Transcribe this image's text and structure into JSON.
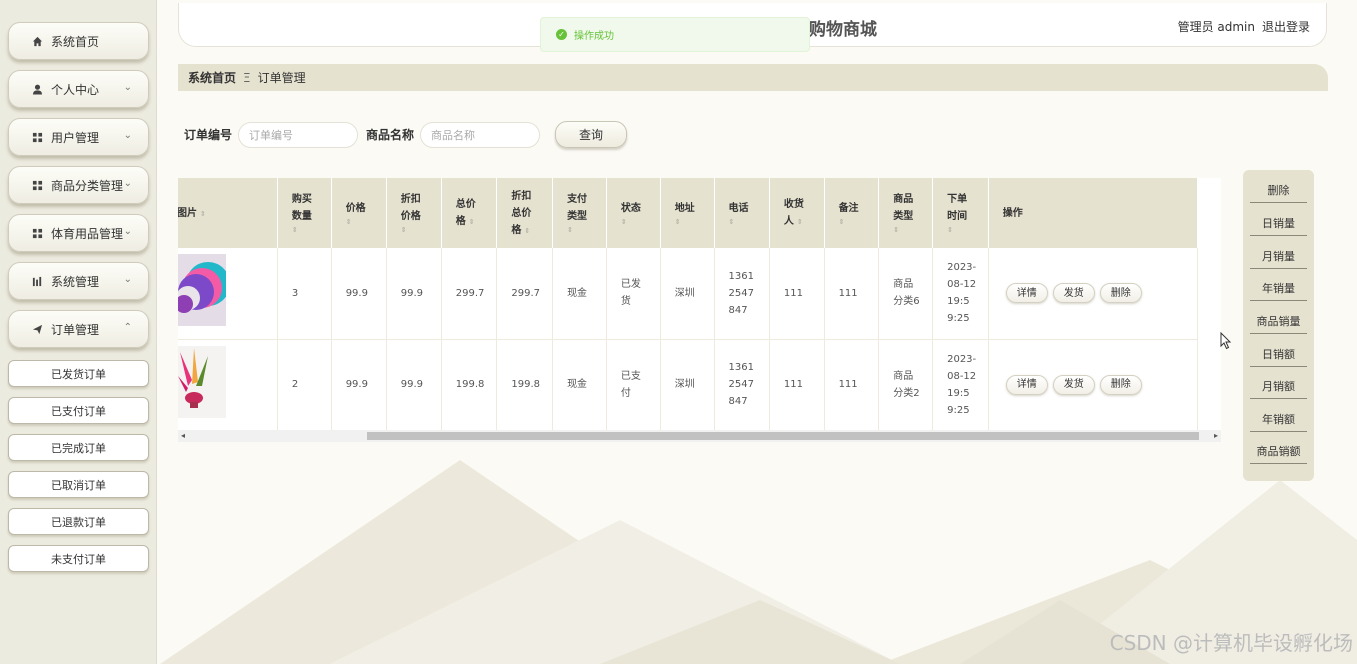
{
  "app": {
    "title": "购物商城",
    "admin_text": "管理员 admin",
    "logout": "退出登录"
  },
  "toast": {
    "text": "操作成功"
  },
  "sidebar": {
    "items": [
      {
        "label": "系统首页",
        "icon": "home-icon",
        "chevron": ""
      },
      {
        "label": "个人中心",
        "icon": "user-icon",
        "chevron": "⌄"
      },
      {
        "label": "用户管理",
        "icon": "grid-icon",
        "chevron": "⌄"
      },
      {
        "label": "商品分类管理",
        "icon": "grid-icon",
        "chevron": "⌄"
      },
      {
        "label": "体育用品管理",
        "icon": "grid-icon",
        "chevron": "⌄"
      },
      {
        "label": "系统管理",
        "icon": "chart-icon",
        "chevron": "⌄"
      },
      {
        "label": "订单管理",
        "icon": "send-icon",
        "chevron": "⌃"
      }
    ],
    "sub_items": [
      "已发货订单",
      "已支付订单",
      "已完成订单",
      "已取消订单",
      "已退款订单",
      "未支付订单"
    ]
  },
  "breadcrumb": {
    "home": "系统首页",
    "sep": "Ξ",
    "current": "订单管理"
  },
  "search": {
    "order_no_label": "订单编号",
    "order_no_placeholder": "订单编号",
    "product_label": "商品名称",
    "product_placeholder": "商品名称",
    "query_button": "查询"
  },
  "table": {
    "headers": [
      "图片",
      "购买数量",
      "价格",
      "折扣价格",
      "总价格",
      "折扣总价格",
      "支付类型",
      "状态",
      "地址",
      "电话",
      "收货人",
      "备注",
      "商品类型",
      "下单时间",
      "操作"
    ],
    "header_lines": [
      [
        "图片"
      ],
      [
        "购买",
        "数量"
      ],
      [
        "价格"
      ],
      [
        "折扣",
        "价格"
      ],
      [
        "总价",
        "格"
      ],
      [
        "折扣",
        "总价",
        "格"
      ],
      [
        "支付",
        "类型"
      ],
      [
        "状态"
      ],
      [
        "地址"
      ],
      [
        "电话"
      ],
      [
        "收货",
        "人"
      ],
      [
        "备注"
      ],
      [
        "商品",
        "类型"
      ],
      [
        "下单",
        "时间"
      ],
      [
        "操作"
      ]
    ],
    "rows": [
      {
        "image": "colorful-fans-image",
        "qty": "3",
        "price": "99.9",
        "discount_price": "99.9",
        "total": "299.7",
        "discount_total": "299.7",
        "pay_type": "现金",
        "status": [
          "已发",
          "货"
        ],
        "address": "深圳",
        "phone": [
          "1361",
          "2547",
          "847"
        ],
        "receiver": "111",
        "remark": "111",
        "category": [
          "商品",
          "分类6"
        ],
        "time": [
          "2023-",
          "08-12",
          "19:5",
          "9:25"
        ]
      },
      {
        "image": "shuttlecock-image",
        "qty": "2",
        "price": "99.9",
        "discount_price": "99.9",
        "total": "199.8",
        "discount_total": "199.8",
        "pay_type": "现金",
        "status": [
          "已支",
          "付"
        ],
        "address": "深圳",
        "phone": [
          "1361",
          "2547",
          "847"
        ],
        "receiver": "111",
        "remark": "111",
        "category": [
          "商品",
          "分类2"
        ],
        "time": [
          "2023-",
          "08-12",
          "19:5",
          "9:25"
        ]
      }
    ],
    "actions": [
      "详情",
      "发货",
      "删除"
    ]
  },
  "right_panel": [
    "删除",
    "日销量",
    "月销量",
    "年销量",
    "商品销量",
    "日销额",
    "月销额",
    "年销额",
    "商品销额"
  ],
  "watermark": "CSDN @计算机毕设孵化场",
  "colors": {
    "sidebar_bg": "#ecebdf",
    "header_bar": "#e6e2d0",
    "success": "#67c23a"
  }
}
